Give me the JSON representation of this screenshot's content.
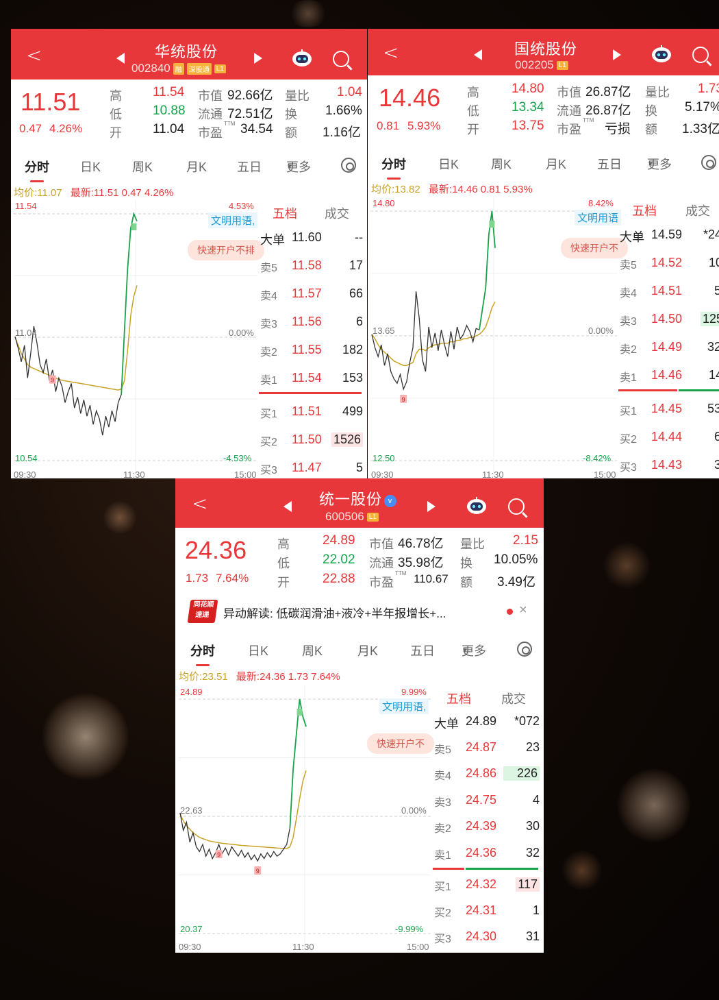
{
  "panels": [
    {
      "header": {
        "name": "华统股份",
        "code": "002840",
        "tags": [
          "融",
          "深股通",
          "L1"
        ]
      },
      "price": "11.51",
      "change": "0.47",
      "change_pct": "4.26%",
      "stats": [
        {
          "k": "高",
          "v": "11.54",
          "color": "red"
        },
        {
          "k": "低",
          "v": "10.88",
          "color": "green"
        },
        {
          "k": "开",
          "v": "11.04",
          "color": "dark"
        }
      ],
      "mid": [
        {
          "k": "市值",
          "v": "92.66亿"
        },
        {
          "k": "流通",
          "v": "72.51亿"
        },
        {
          "k": "市盈",
          "sup": "TTM",
          "v": "34.54"
        }
      ],
      "right": [
        {
          "k": "量比",
          "v": "1.04",
          "color": "red"
        },
        {
          "k": "换",
          "v": "1.66%",
          "color": "dark"
        },
        {
          "k": "额",
          "v": "1.16亿",
          "color": "dark"
        }
      ],
      "tabs": [
        "分时",
        "日K",
        "周K",
        "月K",
        "五日",
        "更多"
      ],
      "info": {
        "avg_label": "均价:",
        "avg": "11.07",
        "latest_label": "最新:",
        "latest": "11.51",
        "chg": "0.47",
        "pct": "4.26%"
      },
      "chart": {
        "top": "11.54",
        "bottom": "10.54",
        "top_pct": "4.53%",
        "bottom_pct": "-4.53%",
        "mid_pct": "0.00%",
        "mid_price": "11.04",
        "times": [
          "09:30",
          "11:30",
          "15:00"
        ],
        "marks": [
          "9"
        ],
        "pill": "快速开户不排",
        "civ": "文明用语,",
        "price_pct": [
          0.02,
          -0.4,
          -0.9,
          -0.3,
          -1.5,
          -0.6,
          0.4,
          -0.2,
          -1.0,
          -1.3,
          -0.8,
          -1.6,
          -1.2,
          -2.0,
          -1.5,
          -1.8,
          -2.4,
          -2.0,
          -1.7,
          -2.6,
          -2.2,
          -2.8,
          -2.3,
          -2.9,
          -2.5,
          -3.2,
          -2.7,
          -3.0,
          -3.6,
          -2.9,
          -3.3,
          -2.7,
          -3.1,
          -2.4,
          -2.1,
          0.2,
          2.5,
          4.0,
          4.53,
          4.26
        ],
        "avg_pct": [
          0.0,
          -0.3,
          -0.6,
          -0.8,
          -1.0,
          -1.1,
          -1.15,
          -1.2,
          -1.25,
          -1.3,
          -1.35,
          -1.4,
          -1.45,
          -1.5,
          -1.55,
          -1.58,
          -1.6,
          -1.62,
          -1.64,
          -1.66,
          -1.68,
          -1.7,
          -1.72,
          -1.74,
          -1.76,
          -1.78,
          -1.8,
          -1.82,
          -1.84,
          -1.86,
          -1.88,
          -1.9,
          -1.92,
          -1.94,
          -1.9,
          -1.6,
          -0.5,
          0.8,
          1.5,
          1.9
        ]
      },
      "orderbook": {
        "header": [
          "五档",
          "成交"
        ],
        "big": {
          "k": "大单",
          "p": "11.60",
          "v": "--"
        },
        "sell": [
          {
            "k": "卖5",
            "p": "11.58",
            "v": "17"
          },
          {
            "k": "卖4",
            "p": "11.57",
            "v": "66"
          },
          {
            "k": "卖3",
            "p": "11.56",
            "v": "6"
          },
          {
            "k": "卖2",
            "p": "11.55",
            "v": "182"
          },
          {
            "k": "卖1",
            "p": "11.54",
            "v": "153"
          }
        ],
        "buy": [
          {
            "k": "买1",
            "p": "11.51",
            "v": "499"
          },
          {
            "k": "买2",
            "p": "11.50",
            "v": "1526"
          },
          {
            "k": "买3",
            "p": "11.47",
            "v": "5"
          }
        ]
      }
    },
    {
      "header": {
        "name": "国统股份",
        "code": "002205",
        "tags": [
          "L1"
        ]
      },
      "price": "14.46",
      "change": "0.81",
      "change_pct": "5.93%",
      "stats": [
        {
          "k": "高",
          "v": "14.80",
          "color": "red"
        },
        {
          "k": "低",
          "v": "13.34",
          "color": "green"
        },
        {
          "k": "开",
          "v": "13.75",
          "color": "red"
        }
      ],
      "mid": [
        {
          "k": "市值",
          "v": "26.87亿"
        },
        {
          "k": "流通",
          "v": "26.87亿"
        },
        {
          "k": "市盈",
          "sup": "TTM",
          "v": "亏损"
        }
      ],
      "right": [
        {
          "k": "量比",
          "v": "1.73",
          "color": "red"
        },
        {
          "k": "换",
          "v": "5.17%",
          "color": "dark"
        },
        {
          "k": "额",
          "v": "1.33亿",
          "color": "dark"
        }
      ],
      "tabs": [
        "分时",
        "日K",
        "周K",
        "月K",
        "五日",
        "更多"
      ],
      "info": {
        "avg_label": "均价:",
        "avg": "13.82",
        "latest_label": "最新:",
        "latest": "14.46",
        "chg": "0.81",
        "pct": "5.93%"
      },
      "chart": {
        "top": "14.80",
        "bottom": "12.50",
        "top_pct": "8.42%",
        "bottom_pct": "-8.42%",
        "mid_pct": "0.00%",
        "mid_price": "13.65",
        "times": [
          "09:30",
          "11:30",
          "15:00"
        ],
        "marks": [
          "9"
        ],
        "pill": "快速开户不",
        "civ": "文明用语",
        "price_pct": [
          0.1,
          -0.8,
          -1.4,
          -0.6,
          -2.0,
          -1.2,
          -2.4,
          -2.9,
          -3.2,
          -2.6,
          -3.6,
          -3.1,
          -1.8,
          -0.8,
          3.0,
          1.2,
          -1.6,
          -2.4,
          0.6,
          -0.8,
          0.2,
          -1.0,
          0.4,
          -0.6,
          -1.4,
          0.3,
          -0.9,
          0.6,
          -0.2,
          0.1,
          0.7,
          0.3,
          -0.4,
          0.5,
          0.4,
          1.8,
          3.2,
          6.8,
          8.42,
          5.93
        ],
        "avg_pct": [
          0.1,
          -0.2,
          -0.6,
          -0.9,
          -1.1,
          -1.3,
          -1.5,
          -1.7,
          -1.8,
          -1.9,
          -2.0,
          -2.0,
          -1.9,
          -1.8,
          -1.2,
          -0.9,
          -0.9,
          -1.0,
          -0.8,
          -0.7,
          -0.6,
          -0.6,
          -0.5,
          -0.5,
          -0.5,
          -0.4,
          -0.4,
          -0.3,
          -0.3,
          -0.2,
          -0.2,
          -0.1,
          -0.1,
          0.0,
          0.1,
          0.3,
          0.6,
          1.2,
          1.9,
          2.3
        ]
      },
      "orderbook": {
        "header": [
          "五档",
          "成交"
        ],
        "big": {
          "k": "大单",
          "p": "14.59",
          "v": "*24"
        },
        "sell": [
          {
            "k": "卖5",
            "p": "14.52",
            "v": "10"
          },
          {
            "k": "卖4",
            "p": "14.51",
            "v": "5"
          },
          {
            "k": "卖3",
            "p": "14.50",
            "v": "125"
          },
          {
            "k": "卖2",
            "p": "14.49",
            "v": "32"
          },
          {
            "k": "卖1",
            "p": "14.46",
            "v": "14"
          }
        ],
        "buy": [
          {
            "k": "买1",
            "p": "14.45",
            "v": "53"
          },
          {
            "k": "买2",
            "p": "14.44",
            "v": "6"
          },
          {
            "k": "买3",
            "p": "14.43",
            "v": "3"
          }
        ]
      }
    },
    {
      "header": {
        "name": "统一股份",
        "code": "600506",
        "tags": [
          "L1"
        ],
        "verified": "v"
      },
      "price": "24.36",
      "change": "1.73",
      "change_pct": "7.64%",
      "stats": [
        {
          "k": "高",
          "v": "24.89",
          "color": "red"
        },
        {
          "k": "低",
          "v": "22.02",
          "color": "green"
        },
        {
          "k": "开",
          "v": "22.88",
          "color": "red"
        }
      ],
      "mid": [
        {
          "k": "市值",
          "v": "46.78亿"
        },
        {
          "k": "流通",
          "v": "35.98亿"
        },
        {
          "k": "市盈",
          "sup": "TTM",
          "v": "110.67"
        }
      ],
      "right": [
        {
          "k": "量比",
          "v": "2.15",
          "color": "red"
        },
        {
          "k": "换",
          "v": "10.05%",
          "color": "dark"
        },
        {
          "k": "额",
          "v": "3.49亿",
          "color": "dark"
        }
      ],
      "notice": {
        "logo": [
          "同花顺",
          "速递"
        ],
        "text": "异动解读: 低碳润滑油+液冷+半年报增长+...",
        "close": "×"
      },
      "tabs": [
        "分时",
        "日K",
        "周K",
        "月K",
        "五日",
        "更多"
      ],
      "info": {
        "avg_label": "均价:",
        "avg": "23.51",
        "latest_label": "最新:",
        "latest": "24.36",
        "chg": "1.73",
        "pct": "7.64%"
      },
      "chart": {
        "top": "24.89",
        "bottom": "20.37",
        "top_pct": "9.99%",
        "bottom_pct": "-9.99%",
        "mid_pct": "0.00%",
        "mid_price": "22.63",
        "times": [
          "09:30",
          "11:30",
          "15:00"
        ],
        "marks": [
          "9",
          "9"
        ],
        "pill": "快速开户不",
        "civ": "文明用语,",
        "price_pct": [
          0.3,
          -1.2,
          -0.5,
          -2.2,
          -1.4,
          -2.6,
          -3.0,
          -2.4,
          -3.4,
          -2.8,
          -3.6,
          -3.1,
          -2.4,
          -3.2,
          -2.7,
          -3.3,
          -2.6,
          -3.0,
          -3.4,
          -2.9,
          -3.5,
          -3.1,
          -3.7,
          -3.3,
          -3.8,
          -3.2,
          -3.6,
          -3.1,
          -3.5,
          -3.0,
          -3.4,
          -3.2,
          -2.8,
          -2.4,
          -1.0,
          4.0,
          7.0,
          9.99,
          8.5,
          7.64
        ],
        "avg_pct": [
          0.2,
          -0.4,
          -0.8,
          -1.1,
          -1.4,
          -1.6,
          -1.8,
          -1.9,
          -2.0,
          -2.1,
          -2.15,
          -2.2,
          -2.25,
          -2.3,
          -2.33,
          -2.36,
          -2.39,
          -2.42,
          -2.45,
          -2.48,
          -2.5,
          -2.52,
          -2.54,
          -2.56,
          -2.58,
          -2.6,
          -2.62,
          -2.64,
          -2.66,
          -2.68,
          -2.7,
          -2.72,
          -2.74,
          -2.75,
          -2.6,
          -1.8,
          -0.2,
          1.5,
          3.0,
          3.9
        ]
      },
      "orderbook": {
        "header": [
          "五档",
          "成交"
        ],
        "big": {
          "k": "大单",
          "p": "24.89",
          "v": "*072"
        },
        "sell": [
          {
            "k": "卖5",
            "p": "24.87",
            "v": "23"
          },
          {
            "k": "卖4",
            "p": "24.86",
            "v": "226"
          },
          {
            "k": "卖3",
            "p": "24.75",
            "v": "4"
          },
          {
            "k": "卖2",
            "p": "24.39",
            "v": "30"
          },
          {
            "k": "卖1",
            "p": "24.36",
            "v": "32"
          }
        ],
        "buy": [
          {
            "k": "买1",
            "p": "24.32",
            "v": "117"
          },
          {
            "k": "买2",
            "p": "24.31",
            "v": "1"
          },
          {
            "k": "买3",
            "p": "24.30",
            "v": "31"
          }
        ]
      }
    }
  ],
  "colors": {
    "up": "#e8373a",
    "down": "#16a34a",
    "avg": "#c9a227",
    "header": "#e8373a"
  }
}
